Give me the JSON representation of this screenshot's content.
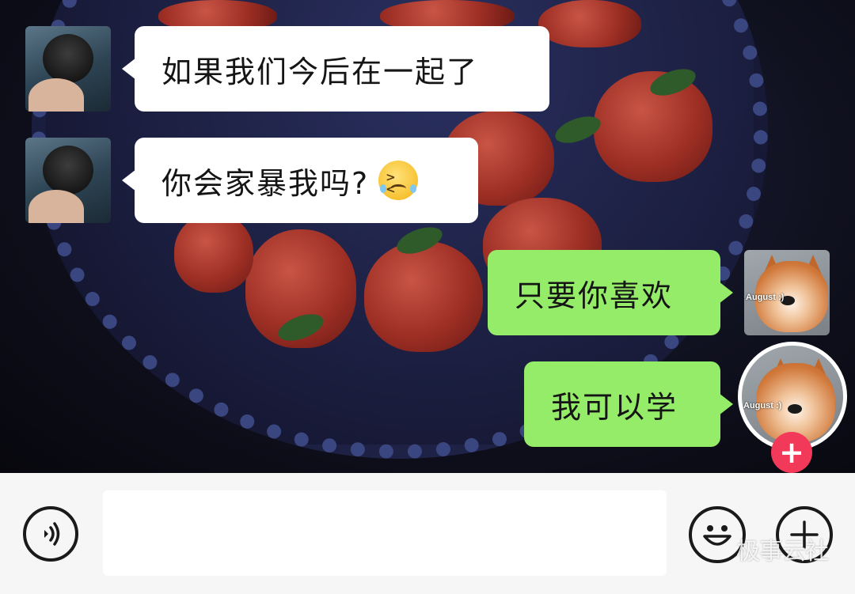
{
  "chat": {
    "messages": [
      {
        "sender": "other",
        "text": "如果我们今后在一起了"
      },
      {
        "sender": "other",
        "text": "你会家暴我吗?",
        "emoji": "tears-of-pain-emoji"
      },
      {
        "sender": "self",
        "text": "只要你喜欢"
      },
      {
        "sender": "self",
        "text": "我可以学"
      }
    ],
    "self_avatar_tag": "August :)",
    "add_badge": "+"
  },
  "input_bar": {
    "message_value": "",
    "voice_icon": "voice-wave-icon",
    "emoji_icon": "smiley-face-icon",
    "more_icon": "plus-circle-icon"
  },
  "watermark": "极事云社",
  "colors": {
    "incoming_bubble": "#ffffff",
    "outgoing_bubble": "#95ec69",
    "badge": "#f2395a",
    "input_bar_bg": "#f6f6f6"
  }
}
